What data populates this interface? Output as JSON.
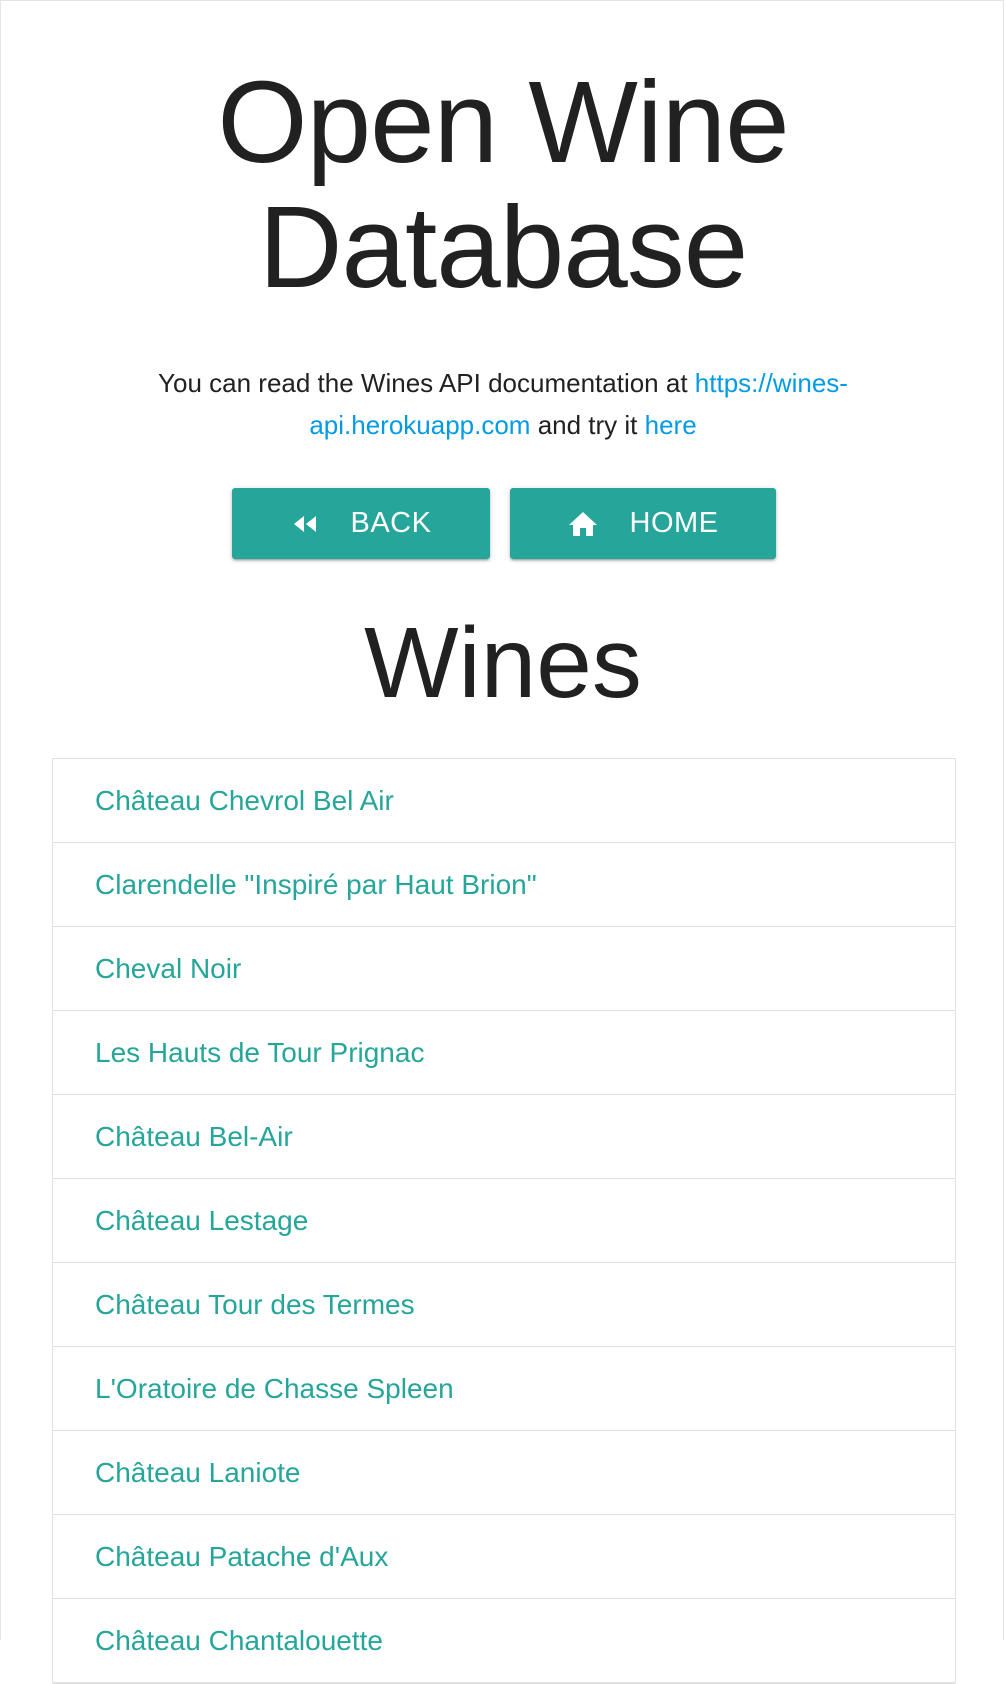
{
  "header": {
    "title": "Open Wine Database"
  },
  "intro": {
    "text_before": "You can read the Wines API documentation at ",
    "doc_link": "https://wines-api.herokuapp.com",
    "text_middle": " and try it ",
    "try_link": "here"
  },
  "buttons": {
    "back_label": "BACK",
    "back_icon": "rewind-icon",
    "home_label": "HOME",
    "home_icon": "home-icon"
  },
  "wines": {
    "title": "Wines",
    "items": [
      "Château Chevrol Bel Air",
      "Clarendelle \"Inspiré par Haut Brion\"",
      "Cheval Noir",
      "Les Hauts de Tour Prignac",
      "Château Bel-Air",
      "Château Lestage",
      "Château Tour des Termes",
      "L'Oratoire de Chasse Spleen",
      "Château Laniote",
      "Château Patache d'Aux",
      "Château Chantalouette"
    ]
  },
  "colors": {
    "accent": "#26a69a",
    "link": "#039be5",
    "text": "#212121",
    "border": "#e0e0e0"
  }
}
